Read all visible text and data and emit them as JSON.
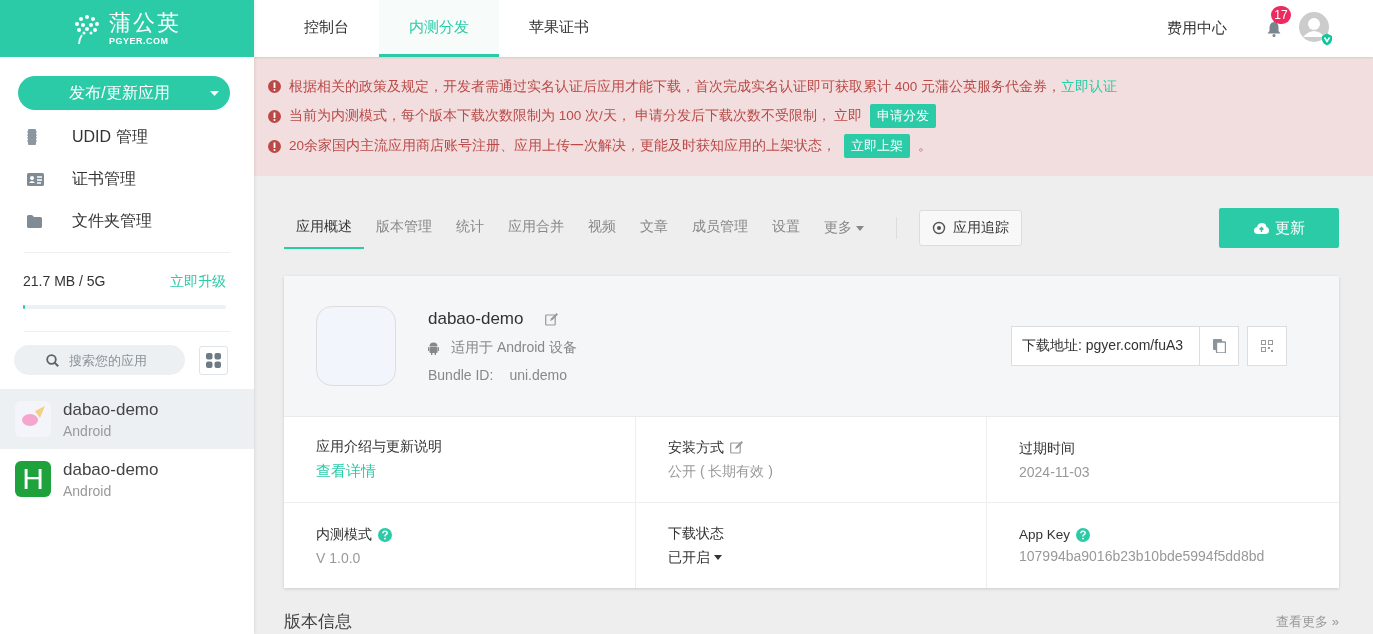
{
  "logo": {
    "name": "蒲公英",
    "domain": "PGYER.COM"
  },
  "sidebar": {
    "publish_button": "发布/更新应用",
    "menu": [
      {
        "label": "UDID 管理",
        "kind": "chip"
      },
      {
        "label": "证书管理",
        "kind": "card"
      },
      {
        "label": "文件夹管理",
        "kind": "folder"
      }
    ],
    "storage": {
      "usage": "21.7 MB / 5G",
      "upgrade": "立即升级",
      "level": 0.01
    },
    "search": {
      "placeholder": "搜索您的应用"
    },
    "apps": [
      {
        "name": "dabao-demo",
        "platform": "Android",
        "selected": true,
        "kind": "image"
      },
      {
        "name": "dabao-demo",
        "platform": "Android",
        "selected": false,
        "kind": "letter",
        "letter": "H"
      }
    ]
  },
  "top_nav": {
    "tabs": [
      {
        "label": "控制台",
        "selected": false
      },
      {
        "label": "内测分发",
        "selected": true
      },
      {
        "label": "苹果证书",
        "selected": false
      }
    ],
    "billing": "费用中心",
    "notification_count": "17"
  },
  "notices": [
    {
      "kind": "link",
      "text": "根据相关的政策及规定，开发者需通过实名认证后应用才能下载，首次完成实名认证即可获取累计 400 元蒲公英服务代金券，",
      "action": "立即认证"
    },
    {
      "kind": "button",
      "text": "当前为内测模式，每个版本下载次数限制为 100 次/天， 申请分发后下载次数不受限制， 立即",
      "action": "申请分发"
    },
    {
      "kind": "button",
      "text": "20余家国内主流应用商店账号注册、应用上传一次解决，更能及时获知应用的上架状态，",
      "action": "立即上架",
      "suffix": "。"
    }
  ],
  "app_tabs": {
    "tabs": [
      {
        "label": "应用概述",
        "selected": true
      },
      {
        "label": "版本管理",
        "selected": false
      },
      {
        "label": "统计",
        "selected": false
      },
      {
        "label": "应用合并",
        "selected": false
      },
      {
        "label": "视频",
        "selected": false
      },
      {
        "label": "文章",
        "selected": false
      },
      {
        "label": "成员管理",
        "selected": false
      },
      {
        "label": "设置",
        "selected": false
      }
    ],
    "more": "更多",
    "track": "应用追踪",
    "update": "更新"
  },
  "app": {
    "name": "dabao-demo",
    "platform_text": "适用于 Android 设备",
    "bundle_label": "Bundle ID:",
    "bundle_id": "uni.demo",
    "download": "下载地址: pgyer.com/fuA3"
  },
  "info": [
    {
      "label": "应用介绍与更新说明",
      "value": "查看详情",
      "kind": "link",
      "edit": false,
      "help": false
    },
    {
      "label": "安装方式",
      "value": "公开 ( 长期有效 )",
      "kind": "text",
      "edit": true,
      "help": false
    },
    {
      "label": "过期时间",
      "value": "2024-11-03",
      "kind": "text",
      "edit": false,
      "help": false
    },
    {
      "label": "内测模式",
      "value": "V 1.0.0",
      "kind": "text",
      "edit": false,
      "help": true
    },
    {
      "label": "下载状态",
      "value": "已开启",
      "kind": "dropdown",
      "edit": false,
      "help": false
    },
    {
      "label": "App Key",
      "value": "107994ba9016b23b10bde5994f5dd8bd",
      "kind": "text",
      "edit": false,
      "help": true
    }
  ],
  "version_section": {
    "title": "版本信息",
    "more": "查看更多 »"
  }
}
